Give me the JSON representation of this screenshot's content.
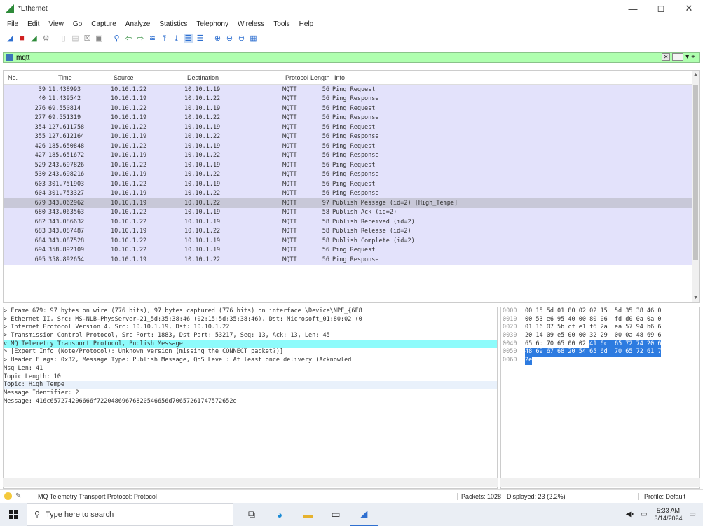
{
  "window": {
    "title": "*Ethernet",
    "min": "—",
    "max": "◻",
    "close": "✕"
  },
  "menu": [
    "File",
    "Edit",
    "View",
    "Go",
    "Capture",
    "Analyze",
    "Statistics",
    "Telephony",
    "Wireless",
    "Tools",
    "Help"
  ],
  "toolbar": [
    "shark-fin-icon",
    "stop-icon",
    "restart-icon",
    "options-icon",
    "sep",
    "open-icon",
    "save-icon",
    "close-file-icon",
    "reload-icon",
    "sep",
    "find-icon",
    "back-icon",
    "forward-icon",
    "goto-icon",
    "first-icon",
    "last-icon",
    "autoscroll-icon",
    "colorize-icon",
    "sep",
    "zoom-in-icon",
    "zoom-out-icon",
    "zoom-normal-icon",
    "resize-columns-icon"
  ],
  "filter": {
    "value": "mqtt",
    "plus": "+"
  },
  "columns": {
    "no": "No.",
    "time": "Time",
    "source": "Source",
    "destination": "Destination",
    "protocol": "Protocol",
    "length": "Length",
    "info": "Info"
  },
  "packets": [
    {
      "no": "39",
      "time": "11.438993",
      "src": "10.10.1.22",
      "dst": "10.10.1.19",
      "proto": "MQTT",
      "len": "56",
      "info": "Ping Request"
    },
    {
      "no": "40",
      "time": "11.439542",
      "src": "10.10.1.19",
      "dst": "10.10.1.22",
      "proto": "MQTT",
      "len": "56",
      "info": "Ping Response"
    },
    {
      "no": "276",
      "time": "69.550814",
      "src": "10.10.1.22",
      "dst": "10.10.1.19",
      "proto": "MQTT",
      "len": "56",
      "info": "Ping Request"
    },
    {
      "no": "277",
      "time": "69.551319",
      "src": "10.10.1.19",
      "dst": "10.10.1.22",
      "proto": "MQTT",
      "len": "56",
      "info": "Ping Response"
    },
    {
      "no": "354",
      "time": "127.611758",
      "src": "10.10.1.22",
      "dst": "10.10.1.19",
      "proto": "MQTT",
      "len": "56",
      "info": "Ping Request"
    },
    {
      "no": "355",
      "time": "127.612164",
      "src": "10.10.1.19",
      "dst": "10.10.1.22",
      "proto": "MQTT",
      "len": "56",
      "info": "Ping Response"
    },
    {
      "no": "426",
      "time": "185.650848",
      "src": "10.10.1.22",
      "dst": "10.10.1.19",
      "proto": "MQTT",
      "len": "56",
      "info": "Ping Request"
    },
    {
      "no": "427",
      "time": "185.651672",
      "src": "10.10.1.19",
      "dst": "10.10.1.22",
      "proto": "MQTT",
      "len": "56",
      "info": "Ping Response"
    },
    {
      "no": "529",
      "time": "243.697826",
      "src": "10.10.1.22",
      "dst": "10.10.1.19",
      "proto": "MQTT",
      "len": "56",
      "info": "Ping Request"
    },
    {
      "no": "530",
      "time": "243.698216",
      "src": "10.10.1.19",
      "dst": "10.10.1.22",
      "proto": "MQTT",
      "len": "56",
      "info": "Ping Response"
    },
    {
      "no": "603",
      "time": "301.751903",
      "src": "10.10.1.22",
      "dst": "10.10.1.19",
      "proto": "MQTT",
      "len": "56",
      "info": "Ping Request"
    },
    {
      "no": "604",
      "time": "301.753327",
      "src": "10.10.1.19",
      "dst": "10.10.1.22",
      "proto": "MQTT",
      "len": "56",
      "info": "Ping Response"
    },
    {
      "no": "679",
      "time": "343.062962",
      "src": "10.10.1.19",
      "dst": "10.10.1.22",
      "proto": "MQTT",
      "len": "97",
      "info": "Publish Message (id=2) [High_Tempe]",
      "selected": true
    },
    {
      "no": "680",
      "time": "343.063563",
      "src": "10.10.1.22",
      "dst": "10.10.1.19",
      "proto": "MQTT",
      "len": "58",
      "info": "Publish Ack (id=2)"
    },
    {
      "no": "682",
      "time": "343.086632",
      "src": "10.10.1.22",
      "dst": "10.10.1.19",
      "proto": "MQTT",
      "len": "58",
      "info": "Publish Received (id=2)"
    },
    {
      "no": "683",
      "time": "343.087487",
      "src": "10.10.1.19",
      "dst": "10.10.1.22",
      "proto": "MQTT",
      "len": "58",
      "info": "Publish Release (id=2)"
    },
    {
      "no": "684",
      "time": "343.087528",
      "src": "10.10.1.22",
      "dst": "10.10.1.19",
      "proto": "MQTT",
      "len": "58",
      "info": "Publish Complete (id=2)"
    },
    {
      "no": "694",
      "time": "358.892109",
      "src": "10.10.1.22",
      "dst": "10.10.1.19",
      "proto": "MQTT",
      "len": "56",
      "info": "Ping Request"
    },
    {
      "no": "695",
      "time": "358.892654",
      "src": "10.10.1.19",
      "dst": "10.10.1.22",
      "proto": "MQTT",
      "len": "56",
      "info": "Ping Response"
    }
  ],
  "details": [
    {
      "text": "> Frame 679: 97 bytes on wire (776 bits), 97 bytes captured (776 bits) on interface \\Device\\NPF_{6F8",
      "style": ""
    },
    {
      "text": "> Ethernet II, Src: MS-NLB-PhysServer-21_5d:35:38:46 (02:15:5d:35:38:46), Dst: Microsoft_01:80:02 (0",
      "style": ""
    },
    {
      "text": "> Internet Protocol Version 4, Src: 10.10.1.19, Dst: 10.10.1.22",
      "style": ""
    },
    {
      "text": "> Transmission Control Protocol, Src Port: 1883, Dst Port: 53217, Seq: 13, Ack: 13, Len: 45",
      "style": ""
    },
    {
      "text": "v MQ Telemetry Transport Protocol, Publish Message",
      "style": "hl"
    },
    {
      "text": "   > [Expert Info (Note/Protocol): Unknown version (missing the CONNECT packet?)]",
      "style": ""
    },
    {
      "text": "   > Header Flags: 0x32, Message Type: Publish Message, QoS Level: At least once delivery (Acknowled",
      "style": ""
    },
    {
      "text": "     Msg Len: 41",
      "style": ""
    },
    {
      "text": "     Topic Length: 10",
      "style": ""
    },
    {
      "text": "     Topic: High_Tempe",
      "style": "sub"
    },
    {
      "text": "     Message Identifier: 2",
      "style": ""
    },
    {
      "text": "     Message: 416c657274206666f72204869676820546656d70657261747572652e",
      "style": ""
    }
  ],
  "bytes": [
    {
      "off": "0000",
      "parts": [
        {
          "t": "00 15 5d 01 80 02 02 15  5d 35 38 46 0",
          "h": false
        }
      ]
    },
    {
      "off": "0010",
      "parts": [
        {
          "t": "00 53 e6 95 40 00 80 06  fd d0 0a 0a 0",
          "h": false
        }
      ]
    },
    {
      "off": "0020",
      "parts": [
        {
          "t": "01 16 07 5b cf e1 f6 2a  ea 57 94 b6 6",
          "h": false
        }
      ]
    },
    {
      "off": "0030",
      "parts": [
        {
          "t": "20 14 09 e5 00 00 32 29  00 0a 48 69 6",
          "h": false
        }
      ]
    },
    {
      "off": "0040",
      "parts": [
        {
          "t": "65 6d 70 65 00 02 ",
          "h": false
        },
        {
          "t": "41 6c  65 72 74 20 6",
          "h": true
        }
      ]
    },
    {
      "off": "0050",
      "parts": [
        {
          "t": "48 69 67 68 20 54 65 6d  70 65 72 61 7",
          "h": true
        }
      ]
    },
    {
      "off": "0060",
      "parts": [
        {
          "t": "2e",
          "h": true
        }
      ]
    }
  ],
  "status": {
    "protocol": "MQ Telemetry Transport Protocol: Protocol",
    "packets": "Packets: 1028 · Displayed: 23 (2.2%)",
    "profile": "Profile: Default"
  },
  "taskbar": {
    "search_placeholder": "Type here to search",
    "time": "5:33 AM",
    "date": "3/14/2024"
  }
}
